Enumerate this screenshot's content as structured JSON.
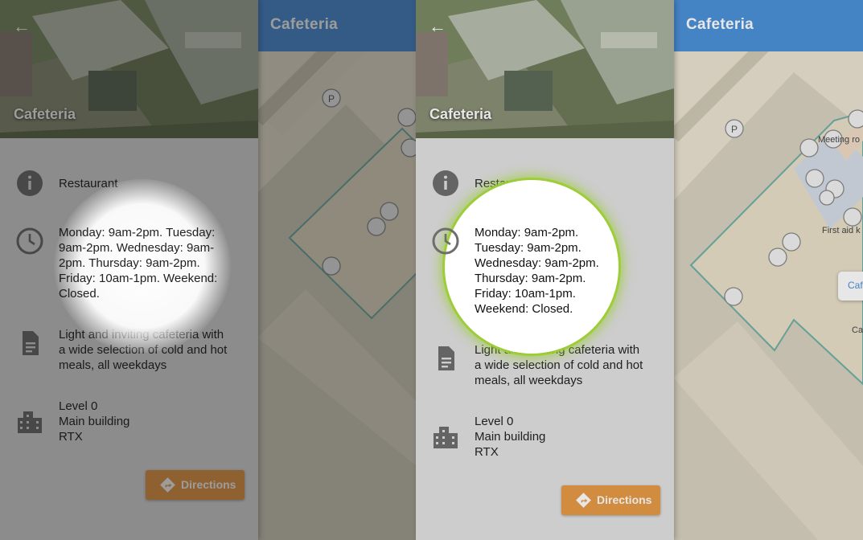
{
  "colors": {
    "topbar": "#4a90d9",
    "accent_button": "#e89a45",
    "panel_bg": "#e3e3e3",
    "map_bg": "#ebe4d2",
    "spotlight_glow": "#9acd32"
  },
  "left": {
    "map": {
      "title": "Cafeteria"
    },
    "panel": {
      "hero_title": "Cafeteria",
      "back_icon": "arrow-left-icon",
      "category": "Restaurant",
      "hours_lines": [
        "Monday: 9am-2pm.  Tuesday:",
        "9am-2pm. Wednesday: 9am-",
        "2pm. Thursday: 9am-2pm.",
        "Friday: 10am-1pm. Weekend:",
        "Closed."
      ],
      "description_lines": [
        "Light and inviting cafeteria with",
        "a wide selection of cold and hot",
        "meals, all weekdays"
      ],
      "location_lines": [
        "Level 0",
        "Main building",
        "RTX"
      ],
      "directions_label": "Directions"
    }
  },
  "right": {
    "map": {
      "title": "Cafeteria",
      "labels": {
        "meeting": "Meeting ro",
        "firstaid": "First aid k",
        "chip": "Caf",
        "cafe_bottom": "Ca"
      }
    },
    "panel": {
      "hero_title": "Cafeteria",
      "back_icon": "arrow-left-icon",
      "category": "Restaurant",
      "hours_lines": [
        "Monday: 9am-2pm.",
        "Tuesday: 9am-2pm.",
        "Wednesday: 9am-2pm.",
        "Thursday: 9am-2pm.",
        "Friday: 10am-1pm.",
        "Weekend: Closed."
      ],
      "description_lines": [
        "Light and inviting cafeteria with",
        "a wide selection of cold and hot",
        "meals, all weekdays"
      ],
      "location_lines": [
        "Level 0",
        "Main building",
        "RTX"
      ],
      "directions_label": "Directions"
    }
  }
}
